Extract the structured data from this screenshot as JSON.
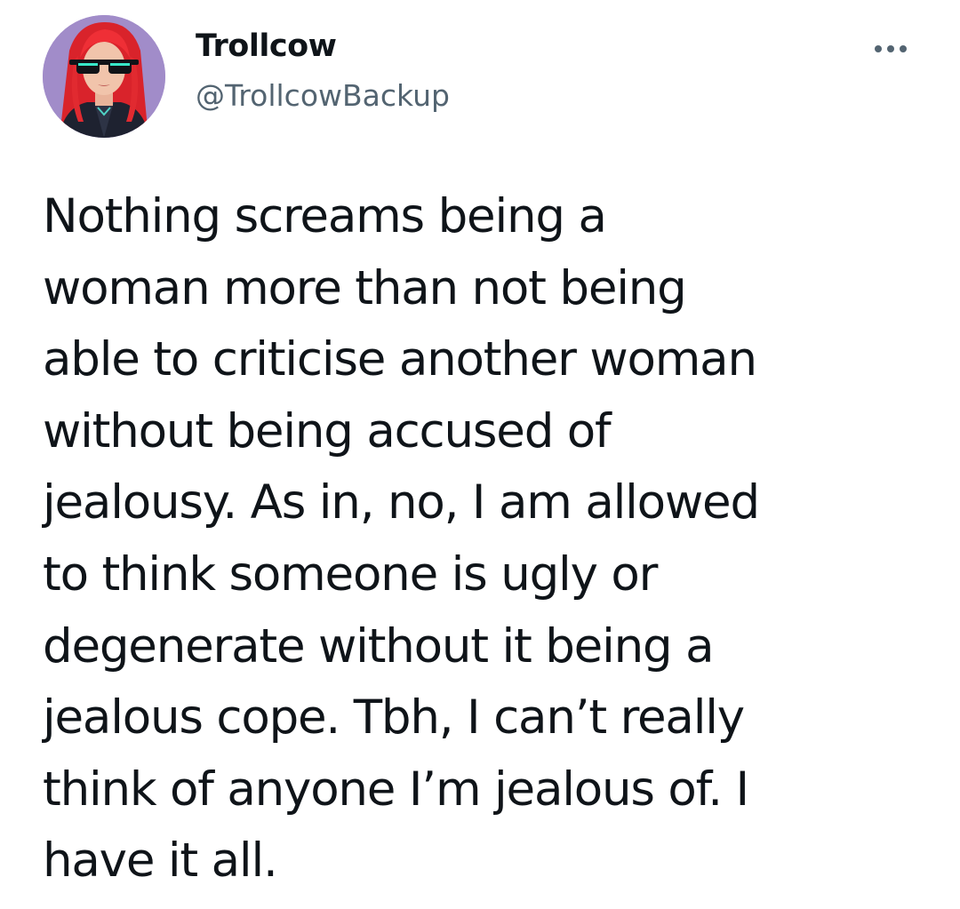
{
  "author": {
    "display_name": "Trollcow",
    "handle": "@TrollcowBackup",
    "avatar_icon": "profile-avatar-icon"
  },
  "menu": {
    "icon": "more-options-icon"
  },
  "tweet": {
    "lines": [
      "Nothing screams being a",
      "woman more than not being",
      "able to criticise another woman",
      "without being accused of",
      "jealousy. As in, no, I am allowed",
      "to think someone is ugly or",
      "degenerate without it being a",
      "jealous cope. Tbh, I can’t really",
      "think of anyone I’m jealous of. I",
      "have it all."
    ]
  },
  "colors": {
    "text_primary": "#0f1419",
    "text_secondary": "#536471",
    "avatar_bg": "#a18cc9",
    "avatar_hair": "#e0262c"
  }
}
